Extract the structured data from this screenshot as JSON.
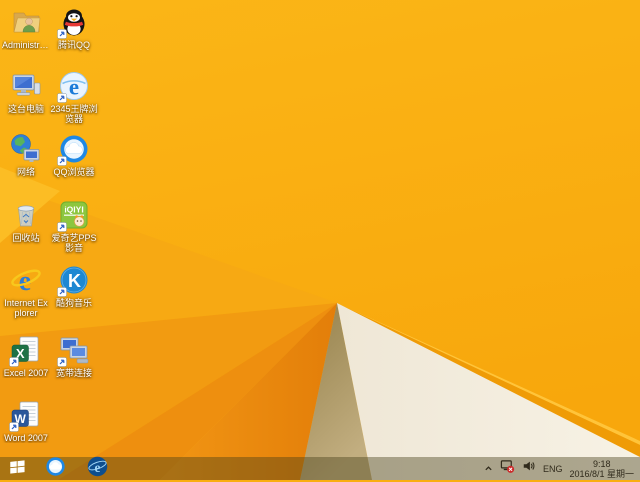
{
  "wallpaper": {
    "base_orange_top": "#FBB617",
    "base_orange_bottom": "#F8A70C",
    "facet_orange_dark": "#E37E09",
    "fold_shadow_tan": "#94804A",
    "fold_paper_white": "#F1EADA",
    "edge_amber": "#EE9705"
  },
  "desktop": {
    "icons": [
      {
        "name": "administrator",
        "label": "Administra..."
      },
      {
        "name": "tencent-qq",
        "label": "腾讯QQ"
      },
      {
        "name": "this-pc",
        "label": "这台电脑"
      },
      {
        "name": "browser-2345",
        "label": "2345王牌浏览器"
      },
      {
        "name": "network",
        "label": "网络"
      },
      {
        "name": "qq-browser",
        "label": "QQ浏览器"
      },
      {
        "name": "recycle-bin",
        "label": "回收站"
      },
      {
        "name": "iqiyi-pps",
        "label": "爱奇艺PPS影音"
      },
      {
        "name": "internet-explorer",
        "label": "Internet Explorer"
      },
      {
        "name": "kugou-music",
        "label": "酷狗音乐"
      },
      {
        "name": "excel-2007",
        "label": "Excel 2007"
      },
      {
        "name": "broadband",
        "label": "宽带连接"
      },
      {
        "name": "word-2007",
        "label": "Word 2007"
      }
    ]
  },
  "icon_glyphs": {
    "e2345": "e",
    "ie": "e",
    "ie_task": "e",
    "kugou": "K",
    "excel": "X",
    "word": "W",
    "iqiyi": "iQIYI"
  },
  "taskbar": {
    "tray": {
      "language": "ENG",
      "time": "9:18",
      "date": "2016/8/1 星期一"
    }
  }
}
